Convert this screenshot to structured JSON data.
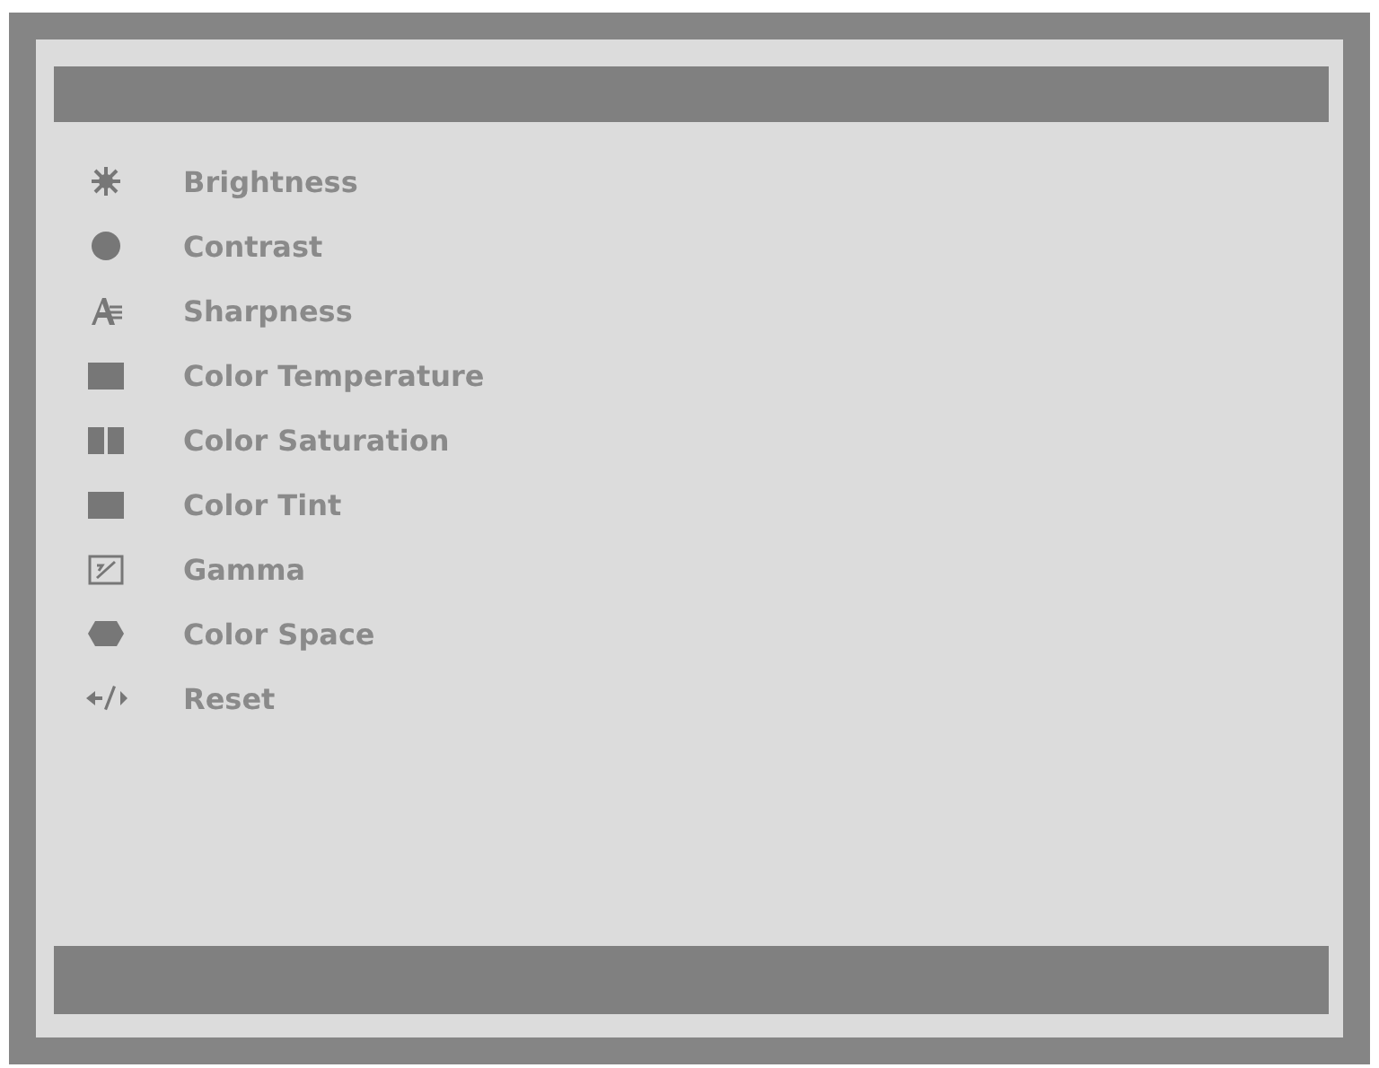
{
  "menu": {
    "items": [
      {
        "label": "Brightness"
      },
      {
        "label": "Contrast"
      },
      {
        "label": "Sharpness"
      },
      {
        "label": "Color Temperature"
      },
      {
        "label": "Color Saturation"
      },
      {
        "label": "Color Tint"
      },
      {
        "label": "Gamma"
      },
      {
        "label": "Color Space"
      },
      {
        "label": "Reset"
      }
    ]
  }
}
